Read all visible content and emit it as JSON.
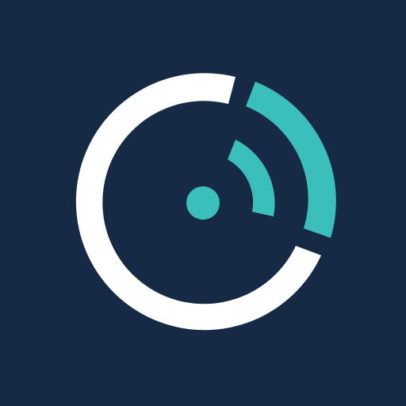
{
  "icon": {
    "name": "signal-ring-logo-icon",
    "colors": {
      "background": "#172a45",
      "ring": "#ffffff",
      "accent": "#3bbfbc"
    }
  }
}
